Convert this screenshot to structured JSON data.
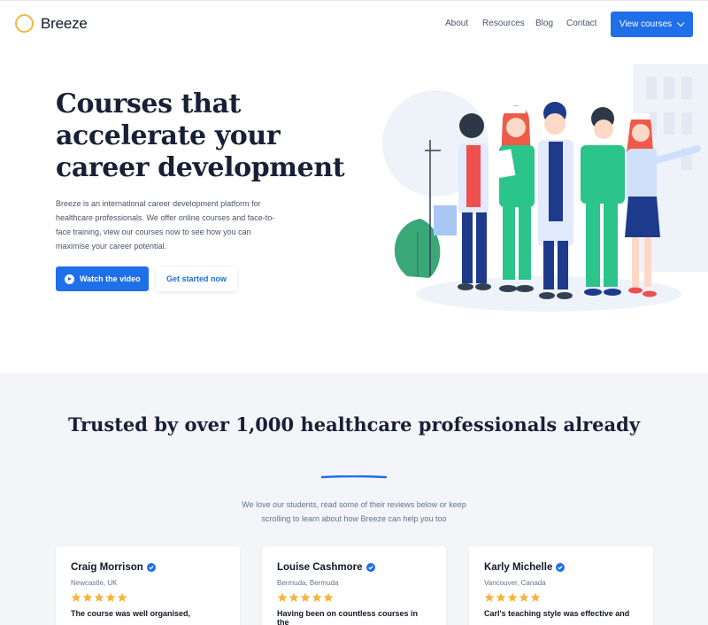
{
  "brand": {
    "name": "Breeze",
    "logo_color": "#f0b93f"
  },
  "nav": {
    "items": [
      "About",
      "Resources",
      "Blog",
      "Contact"
    ],
    "cta_label": "View courses"
  },
  "hero": {
    "title": "Courses that accelerate your career development",
    "body": "Breeze is an international career development platform for healthcare professionals. We offer online courses and face-to-face training, view our courses now to see how you can maximise your career potential.",
    "watch_label": "Watch the video",
    "start_label": "Get started now"
  },
  "trust": {
    "title": "Trusted by over 1,000 healthcare professionals already",
    "subtitle_line1": "We love our students, read some of their reviews below or keep",
    "subtitle_line2": "scrolling to learn about how Breeze can help you too"
  },
  "reviews": [
    {
      "name": "Craig Morrison",
      "location": "Newcastle, UK",
      "rating": 5,
      "quote": "The course was well organised,"
    },
    {
      "name": "Louise Cashmore",
      "location": "Bermuda, Bermuda",
      "rating": 5,
      "quote": "Having been on countless courses in the"
    },
    {
      "name": "Karly Michelle",
      "location": "Vancouver, Canada",
      "rating": 5,
      "quote": "Carl's teaching style was effective and"
    }
  ],
  "colors": {
    "accent": "#1f6fe8",
    "star": "#f5b43b",
    "section_bg": "#f3f5f9"
  },
  "icons": [
    "play-icon",
    "chevron-down-icon",
    "verified-icon",
    "star-icon"
  ]
}
